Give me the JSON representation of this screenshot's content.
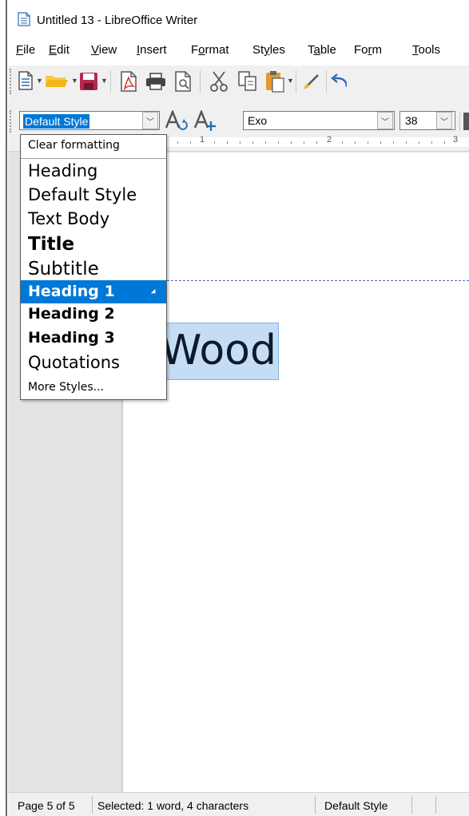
{
  "window": {
    "title": "Untitled 13 - LibreOffice Writer",
    "icon": "writer-document-icon"
  },
  "menubar": {
    "items": [
      {
        "label": "File",
        "accel": "F"
      },
      {
        "label": "Edit",
        "accel": "E"
      },
      {
        "label": "View",
        "accel": "V"
      },
      {
        "label": "Insert",
        "accel": "I"
      },
      {
        "label": "Format",
        "accel": "o"
      },
      {
        "label": "Styles",
        "accel": "y"
      },
      {
        "label": "Table",
        "accel": "a"
      },
      {
        "label": "Form",
        "accel": "r"
      },
      {
        "label": "Tools",
        "accel": "T"
      }
    ]
  },
  "toolbar": {
    "icons": [
      "new-document-icon",
      "open-folder-icon",
      "save-icon",
      "export-pdf-icon",
      "print-icon",
      "print-preview-icon",
      "cut-icon",
      "copy-icon",
      "paste-icon",
      "clone-formatting-icon",
      "undo-icon"
    ]
  },
  "formatting": {
    "paragraph_style": "Default Style",
    "font_name": "Exo",
    "font_size": "38"
  },
  "ruler": {
    "labels": [
      "1",
      "2",
      "3"
    ]
  },
  "style_dropdown": {
    "clear_formatting": "Clear formatting",
    "items": [
      "Heading",
      "Default Style",
      "Text Body",
      "Title",
      "Subtitle",
      "Heading 1",
      "Heading 2",
      "Heading 3",
      "Quotations"
    ],
    "highlighted": "Heading 1",
    "more_styles": "More Styles..."
  },
  "document": {
    "selected_text": "Wood"
  },
  "statusbar": {
    "page": "Page 5 of 5",
    "selection": "Selected: 1 word, 4 characters",
    "style": "Default Style"
  },
  "colors": {
    "accent": "#0078d7",
    "selection_highlight": "#c5dcf5",
    "page_break_line": "#5b6acb"
  }
}
